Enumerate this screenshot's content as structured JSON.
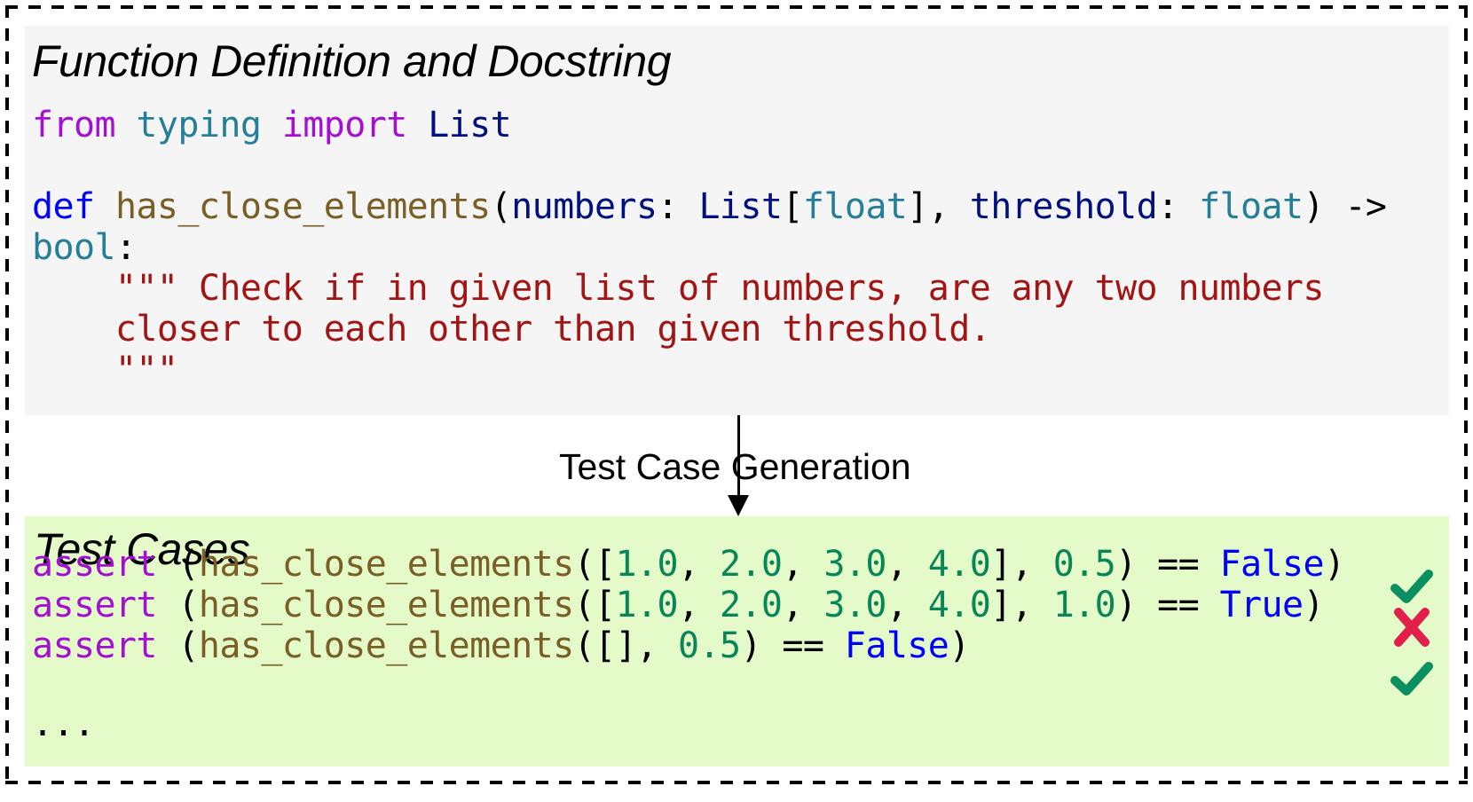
{
  "definition_panel": {
    "heading": "Function Definition and Docstring",
    "code_lines": [
      [
        {
          "text": "from",
          "role": "keyword"
        },
        {
          "text": " ",
          "role": "punct"
        },
        {
          "text": "typing",
          "role": "module"
        },
        {
          "text": " ",
          "role": "punct"
        },
        {
          "text": "import",
          "role": "keyword"
        },
        {
          "text": " ",
          "role": "punct"
        },
        {
          "text": "List",
          "role": "class"
        }
      ],
      [],
      [
        {
          "text": "def",
          "role": "def"
        },
        {
          "text": " ",
          "role": "punct"
        },
        {
          "text": "has_close_elements",
          "role": "function"
        },
        {
          "text": "(",
          "role": "punct"
        },
        {
          "text": "numbers",
          "role": "param"
        },
        {
          "text": ": ",
          "role": "punct"
        },
        {
          "text": "List",
          "role": "class"
        },
        {
          "text": "[",
          "role": "punct"
        },
        {
          "text": "float",
          "role": "module"
        },
        {
          "text": "], ",
          "role": "punct"
        },
        {
          "text": "threshold",
          "role": "param"
        },
        {
          "text": ": ",
          "role": "punct"
        },
        {
          "text": "float",
          "role": "module"
        },
        {
          "text": ") ->",
          "role": "punct"
        }
      ],
      [
        {
          "text": "bool",
          "role": "module"
        },
        {
          "text": ":",
          "role": "punct"
        }
      ],
      [
        {
          "text": "    \"\"\" Check if in given list of numbers, are any two numbers",
          "role": "string"
        }
      ],
      [
        {
          "text": "    closer to each other than given threshold.",
          "role": "string"
        }
      ],
      [
        {
          "text": "    \"\"\"",
          "role": "string"
        }
      ]
    ]
  },
  "arrow": {
    "label": "Test Case Generation"
  },
  "test_panel": {
    "heading": "Test Cases",
    "test_lines": [
      {
        "tokens": [
          {
            "text": "assert",
            "role": "keyword"
          },
          {
            "text": " (",
            "role": "punct"
          },
          {
            "text": "has_close_elements",
            "role": "function"
          },
          {
            "text": "([",
            "role": "punct"
          },
          {
            "text": "1.0",
            "role": "number"
          },
          {
            "text": ", ",
            "role": "punct"
          },
          {
            "text": "2.0",
            "role": "number"
          },
          {
            "text": ", ",
            "role": "punct"
          },
          {
            "text": "3.0",
            "role": "number"
          },
          {
            "text": ", ",
            "role": "punct"
          },
          {
            "text": "4.0",
            "role": "number"
          },
          {
            "text": "], ",
            "role": "punct"
          },
          {
            "text": "0.5",
            "role": "number"
          },
          {
            "text": ") == ",
            "role": "punct"
          },
          {
            "text": "False",
            "role": "constant"
          },
          {
            "text": ")",
            "role": "punct"
          }
        ],
        "status": "pass",
        "status_icon": "check-icon"
      },
      {
        "tokens": [
          {
            "text": "assert",
            "role": "keyword"
          },
          {
            "text": " (",
            "role": "punct"
          },
          {
            "text": "has_close_elements",
            "role": "function"
          },
          {
            "text": "([",
            "role": "punct"
          },
          {
            "text": "1.0",
            "role": "number"
          },
          {
            "text": ", ",
            "role": "punct"
          },
          {
            "text": "2.0",
            "role": "number"
          },
          {
            "text": ", ",
            "role": "punct"
          },
          {
            "text": "3.0",
            "role": "number"
          },
          {
            "text": ", ",
            "role": "punct"
          },
          {
            "text": "4.0",
            "role": "number"
          },
          {
            "text": "], ",
            "role": "punct"
          },
          {
            "text": "1.0",
            "role": "number"
          },
          {
            "text": ") == ",
            "role": "punct"
          },
          {
            "text": "True",
            "role": "constant"
          },
          {
            "text": ")",
            "role": "punct"
          }
        ],
        "status": "fail",
        "status_icon": "cross-icon"
      },
      {
        "tokens": [
          {
            "text": "assert",
            "role": "keyword"
          },
          {
            "text": " (",
            "role": "punct"
          },
          {
            "text": "has_close_elements",
            "role": "function"
          },
          {
            "text": "([], ",
            "role": "punct"
          },
          {
            "text": "0.5",
            "role": "number"
          },
          {
            "text": ") == ",
            "role": "punct"
          },
          {
            "text": "False",
            "role": "constant"
          },
          {
            "text": ")",
            "role": "punct"
          }
        ],
        "status": "pass",
        "status_icon": "check-icon"
      }
    ],
    "ellipsis": "..."
  },
  "colors": {
    "definition_background": "#f5f5f5",
    "test_background": "#e4fbc9",
    "pass": "#0a8f60",
    "fail": "#e0204a"
  }
}
